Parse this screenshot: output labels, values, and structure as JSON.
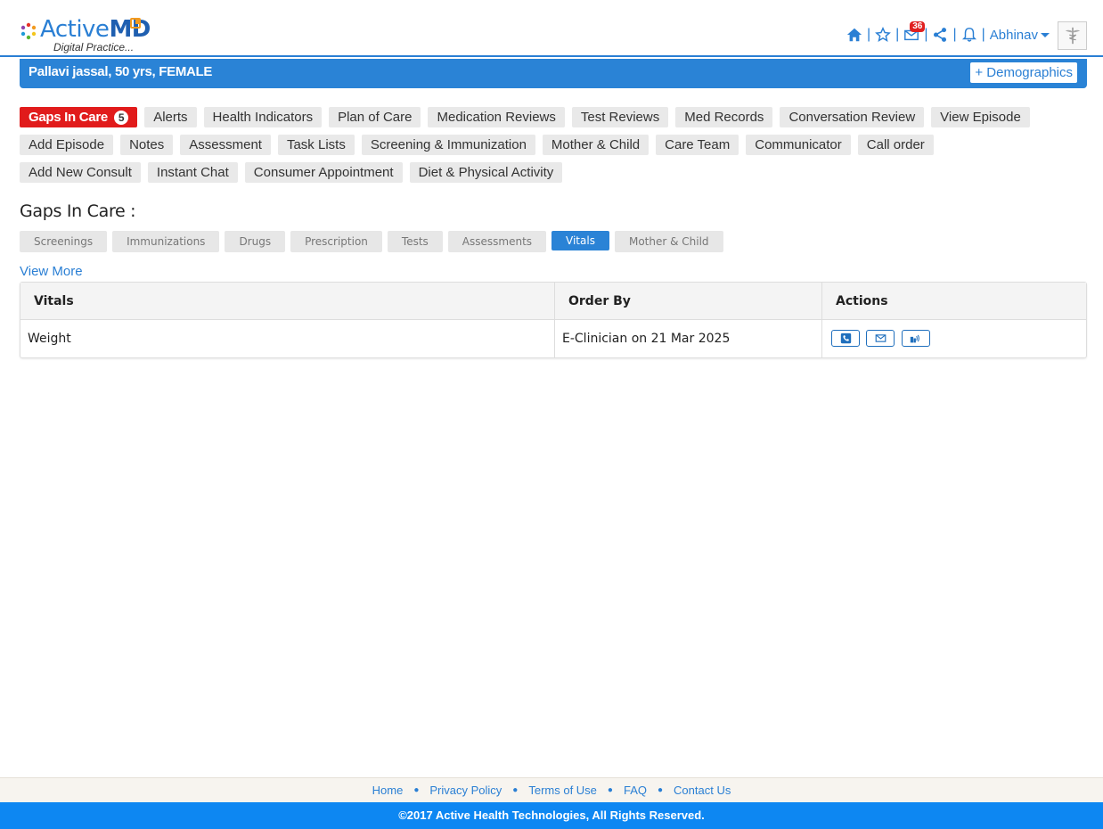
{
  "brand": {
    "name_light": "Active",
    "name_bold": "MD",
    "tagline": "Digital Practice..."
  },
  "header": {
    "user_name": "Abhinav",
    "mail_count": "36",
    "icons": [
      "home-icon",
      "star-icon",
      "mail-icon",
      "share-icon",
      "bell-icon"
    ]
  },
  "patient": {
    "summary": "Pallavi jassal, 50 yrs, FEMALE",
    "demographics_label": "+ Demographics"
  },
  "navtabs": {
    "row1": [
      "Alerts",
      "Health Indicators",
      "Plan of Care",
      "Medication Reviews",
      "Test Reviews",
      "Med Records",
      "Conversation Review",
      "View Episode"
    ],
    "row2": [
      "Add Episode",
      "Notes",
      "Assessment",
      "Task Lists",
      "Screening & Immunization",
      "Mother & Child",
      "Care Team",
      "Communicator",
      "Call order"
    ],
    "row3": [
      "Add New Consult",
      "Instant Chat",
      "Consumer Appointment",
      "Diet & Physical Activity"
    ],
    "active": {
      "label": "Gaps In Care",
      "count": "5"
    }
  },
  "section": {
    "title": "Gaps In Care :",
    "subtabs": [
      "Screenings",
      "Immunizations",
      "Drugs",
      "Prescription",
      "Tests",
      "Assessments",
      "Vitals",
      "Mother & Child"
    ],
    "active_subtab": "Vitals",
    "view_more": "View More"
  },
  "table": {
    "headers": [
      "Vitals",
      "Order By",
      "Actions"
    ],
    "rows": [
      {
        "vital": "Weight",
        "order_by": "E-Clinician on 21 Mar 2025",
        "actions": [
          "phone-icon",
          "envelope-icon",
          "voice-icon"
        ]
      }
    ]
  },
  "footer": {
    "links": [
      "Home",
      "Privacy Policy",
      "Terms of Use",
      "FAQ",
      "Contact Us"
    ],
    "copyright": "©2017 Active Health Technologies, All Rights Reserved."
  },
  "colors": {
    "primary": "#2a83d6",
    "alert": "#e11b1b",
    "footer": "#0d87f2"
  }
}
